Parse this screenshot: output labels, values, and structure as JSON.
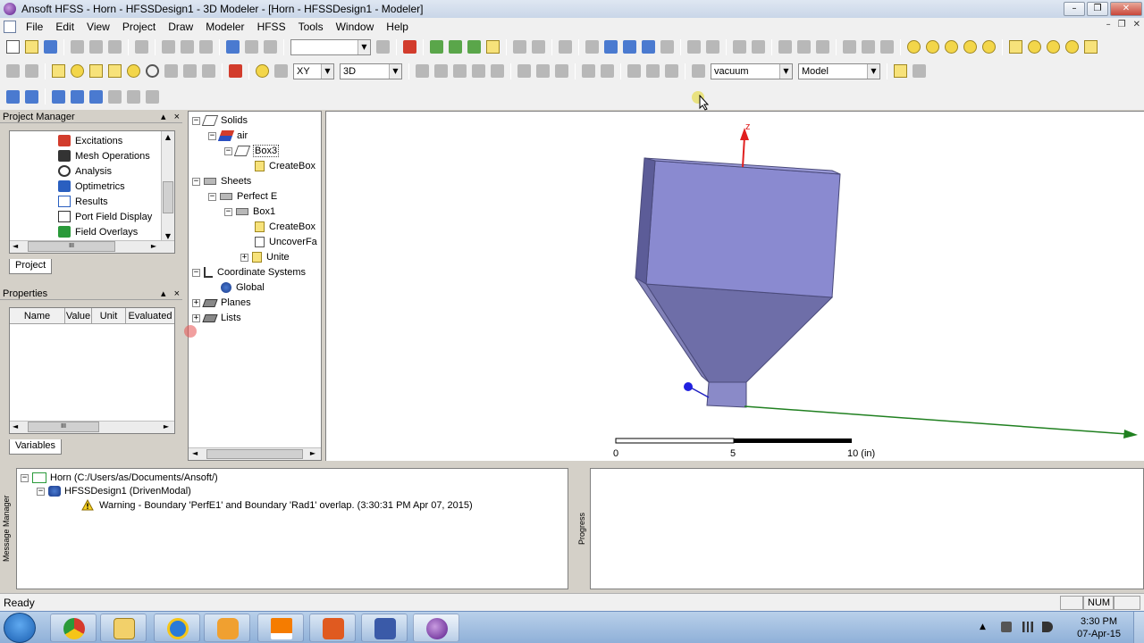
{
  "window": {
    "title": "Ansoft HFSS - Horn - HFSSDesign1 - 3D Modeler - [Horn - HFSSDesign1 - Modeler]",
    "min": "–",
    "restore": "❐",
    "close": "✕"
  },
  "mdi": {
    "min": "–",
    "restore": "❐",
    "close": "✕"
  },
  "menu": [
    "File",
    "Edit",
    "View",
    "Project",
    "Draw",
    "Modeler",
    "HFSS",
    "Tools",
    "Window",
    "Help"
  ],
  "toolbar": {
    "plane_select": "XY",
    "view_mode": "3D",
    "material": "vacuum",
    "model_mode": "Model",
    "combo_arrow": "▼"
  },
  "project_manager": {
    "title": "Project Manager",
    "pin": "▴",
    "close": "×",
    "items": [
      {
        "label": "Excitations",
        "color": "#d23c2c"
      },
      {
        "label": "Mesh Operations",
        "color": "#333333"
      },
      {
        "label": "Analysis",
        "color": "#333333"
      },
      {
        "label": "Optimetrics",
        "color": "#2a5fc0"
      },
      {
        "label": "Results",
        "color": "#2a5fc0"
      },
      {
        "label": "Port Field Display",
        "color": "#333333"
      },
      {
        "label": "Field Overlays",
        "color": "#2a9a3a"
      }
    ],
    "tab": "Project",
    "scroll_up": "▲",
    "scroll_down": "▼",
    "scroll_left": "◄",
    "scroll_right": "►",
    "grip": "III"
  },
  "properties": {
    "title": "Properties",
    "pin": "▴",
    "close": "×",
    "columns": [
      "Name",
      "Value",
      "Unit",
      "Evaluated"
    ],
    "tab": "Variables",
    "scroll_left": "◄",
    "scroll_right": "►",
    "grip": "III"
  },
  "model_tree": {
    "collapse": "−",
    "expand": "+",
    "solids": "Solids",
    "air": "air",
    "box3": "Box3",
    "createbox_a": "CreateBox",
    "sheets": "Sheets",
    "perfect_e": "Perfect E",
    "box1": "Box1",
    "createbox_b": "CreateBox",
    "uncover": "UncoverFa",
    "unite": "Unite",
    "coord_systems": "Coordinate Systems",
    "global": "Global",
    "planes": "Planes",
    "lists": "Lists",
    "scroll_left": "◄",
    "scroll_right": "►"
  },
  "viewport": {
    "axis_z": "z",
    "scale_labels": [
      "0",
      "5",
      "10 (in)"
    ]
  },
  "messages": {
    "side_label": "Message Manager",
    "project": "Horn (C:/Users/as/Documents/Ansoft/)",
    "design": "HFSSDesign1 (DrivenModal)",
    "warning": "Warning - Boundary 'PerfE1' and Boundary 'Rad1' overlap. (3:30:31 PM  Apr 07, 2015)",
    "collapse": "−"
  },
  "progress": {
    "side_label": "Progress"
  },
  "status": {
    "text": "Ready",
    "num": "NUM"
  },
  "taskbar": {
    "time": "3:30 PM",
    "date": "07-Apr-15",
    "tray_arrow": "▲"
  }
}
